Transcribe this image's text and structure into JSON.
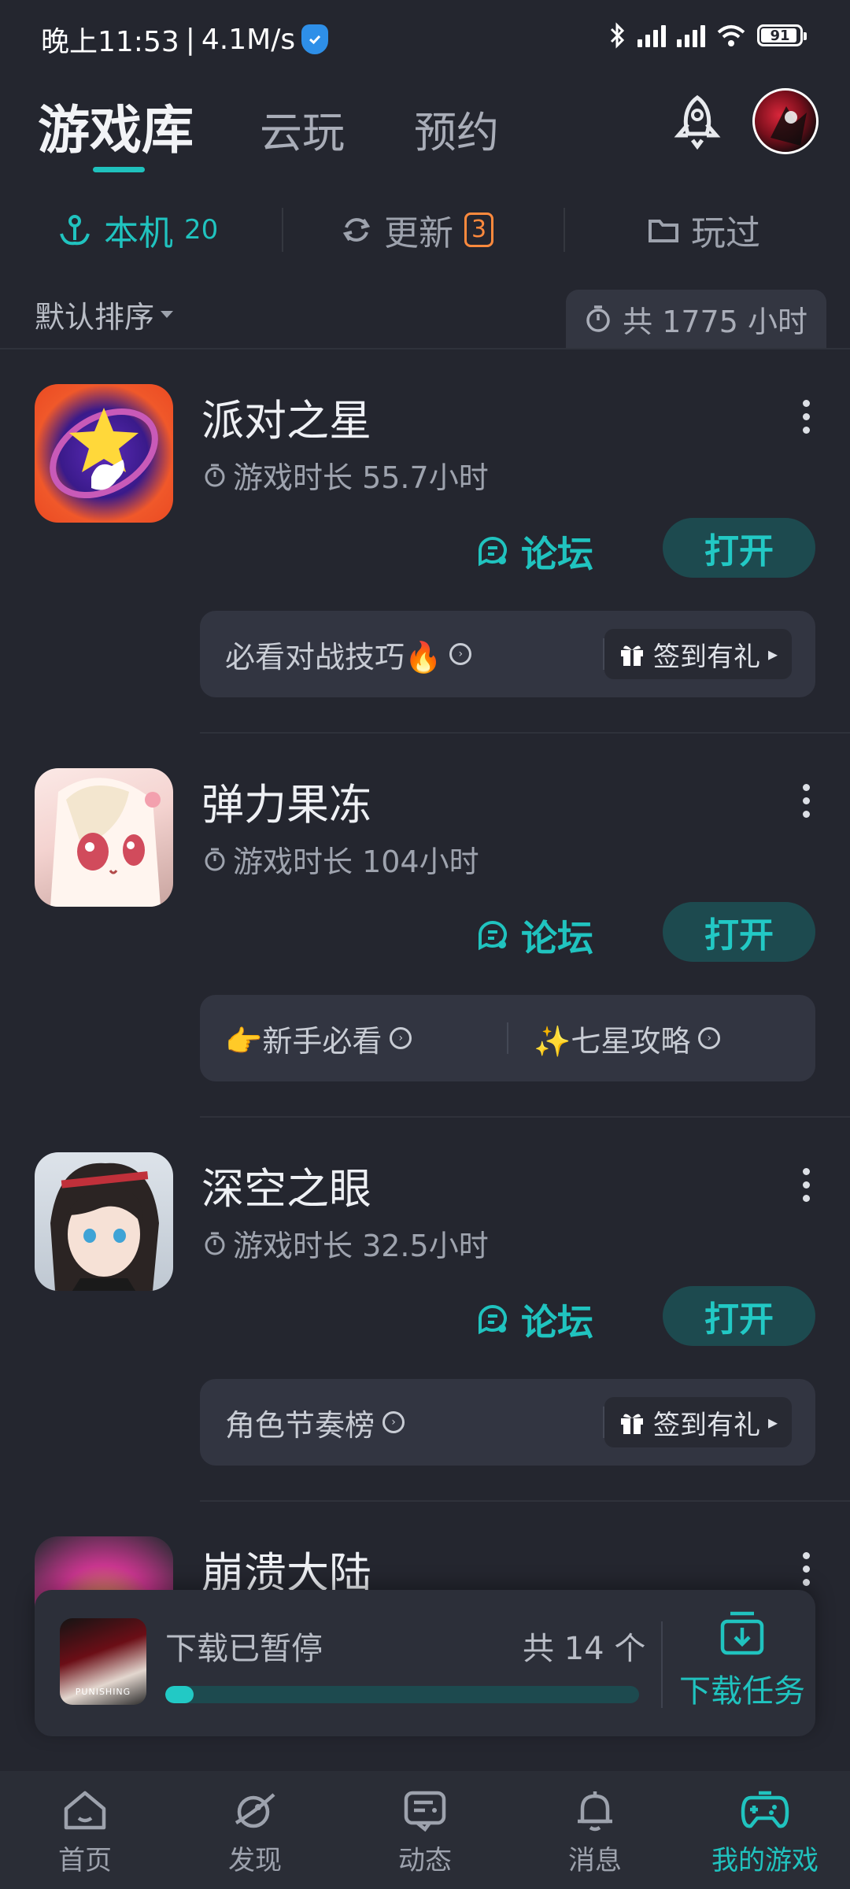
{
  "status_bar": {
    "time": "晚上11:53",
    "speed": "4.1M/s",
    "battery": "91"
  },
  "header": {
    "tabs": [
      {
        "label": "游戏库",
        "active": true
      },
      {
        "label": "云玩",
        "active": false
      },
      {
        "label": "预约",
        "active": false
      }
    ],
    "icons": [
      "rocket-icon",
      "avatar"
    ]
  },
  "subtabs": {
    "local": {
      "label": "本机",
      "count": "20"
    },
    "updates": {
      "label": "更新",
      "badge": "3"
    },
    "played": {
      "label": "玩过"
    }
  },
  "sort": {
    "label": "默认排序",
    "total_hours": "共 1775 小时"
  },
  "games": [
    {
      "name": "派对之星",
      "playtime": "游戏时长 55.7小时",
      "forum": "论坛",
      "open": "打开",
      "promo_left": "必看对战技巧🔥",
      "promo_right": "签到有礼"
    },
    {
      "name": "弹力果冻",
      "playtime": "游戏时长 104小时",
      "forum": "论坛",
      "open": "打开",
      "promo_left": "👉新手必看",
      "promo_right": "✨七星攻略"
    },
    {
      "name": "深空之眼",
      "playtime": "游戏时长 32.5小时",
      "forum": "论坛",
      "open": "打开",
      "promo_left": "角色节奏榜",
      "promo_right": "签到有礼"
    },
    {
      "name": "崩溃大陆"
    }
  ],
  "download": {
    "status": "下载已暂停",
    "count": "共 14 个",
    "progress_pct": 6,
    "thumb_text": "PUNISHING",
    "task_label": "下载任务"
  },
  "bottom_nav": [
    {
      "label": "首页",
      "icon": "home-icon"
    },
    {
      "label": "发现",
      "icon": "discover-icon"
    },
    {
      "label": "动态",
      "icon": "feed-icon"
    },
    {
      "label": "消息",
      "icon": "bell-icon"
    },
    {
      "label": "我的游戏",
      "icon": "gamepad-icon",
      "active": true
    }
  ],
  "colors": {
    "accent": "#20c3bf",
    "background": "#24262f",
    "badge": "#ff8a3d"
  }
}
